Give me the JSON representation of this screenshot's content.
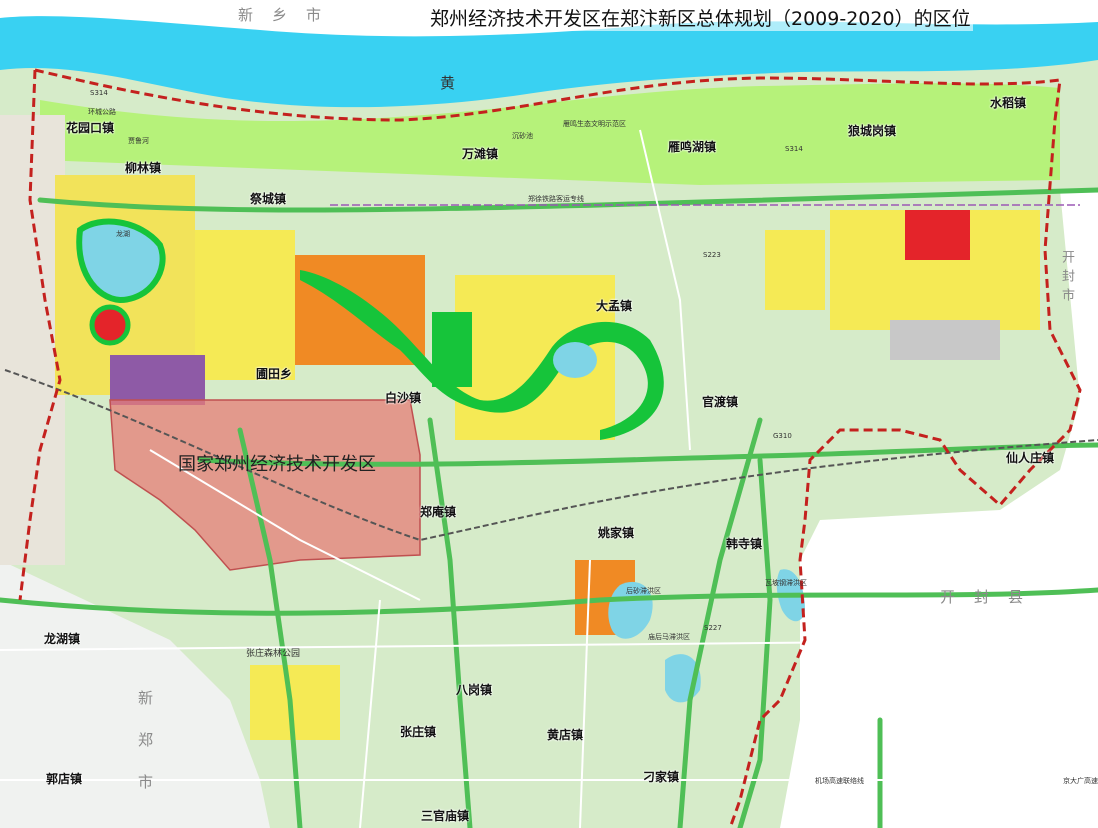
{
  "title": "郑州经济技术开发区在郑汴新区总体规划（2009-2020）的区位",
  "zone_label": "国家郑州经济技术开发区",
  "regions": {
    "xinxiang": "新　乡　市",
    "kaifeng": "开　封　县",
    "xinzheng": "新　郑　市",
    "kaifeng_city": "开封市"
  },
  "river": "黄",
  "towns": {
    "huayuankou": "花园口镇",
    "liulin": "柳林镇",
    "jicheng": "祭城镇",
    "wantan": "万滩镇",
    "yanminghu": "雁鸣湖镇",
    "langchenggang": "狼城岗镇",
    "shuidao": "水稻镇",
    "dameng": "大孟镇",
    "putian": "圃田乡",
    "baisha": "白沙镇",
    "guandu": "官渡镇",
    "renzhuang": "仙人庄镇",
    "zhengan": "郑庵镇",
    "yaojia": "姚家镇",
    "hansi": "韩寺镇",
    "longhu": "龙湖镇",
    "bagang": "八岗镇",
    "zhangzhuang": "张庄镇",
    "huangdian": "黄店镇",
    "diaojia": "刁家镇",
    "guodian": "郭店镇",
    "sanguanmiao": "三官庙镇"
  },
  "small_labels": {
    "s314_a": "S314",
    "s314_b": "S314",
    "huanghe_rd": "环城公路",
    "jialuhe": "贾鲁河",
    "yanming_park": "雁鸣生态文明示范区",
    "chenshachi": "沉砂池",
    "zhengbian_rail": "郑徐铁路客运专线",
    "longhu_lake": "龙湖",
    "zhangzhuang_park": "张庄森林公园",
    "houshahu": "后砂滞洪区",
    "nanhou": "庙后马滞洪区",
    "waduhu": "瓦坡钢滞洪区",
    "s223": "S223",
    "s227": "S227",
    "g310": "G310",
    "jichang": "机场高速联络线",
    "jingda": "京大广高速"
  },
  "colors": {
    "river": "#39d1f2",
    "greenbelt": "#b6f27a",
    "farmland": "#d6ebc9",
    "park": "#16c43a",
    "residential": "#f5ea55",
    "commercial": "#e4242a",
    "industrial": "#8e5aa6",
    "orange": "#f08a24",
    "zone_overlay": "#e57e77",
    "road_green": "#4fbf56",
    "boundary": "#c4211e",
    "lake": "#7fd4e6"
  }
}
